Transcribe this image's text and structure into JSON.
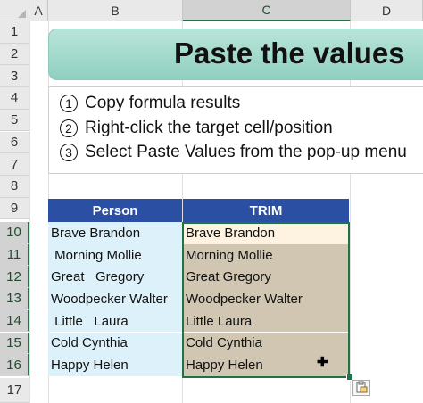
{
  "columns": [
    "A",
    "B",
    "C",
    "D"
  ],
  "rows": [
    "1",
    "2",
    "3",
    "4",
    "5",
    "6",
    "7",
    "8",
    "9",
    "10",
    "11",
    "12",
    "13",
    "14",
    "15",
    "16",
    "17"
  ],
  "banner": {
    "title": "Paste the values"
  },
  "steps": [
    {
      "num": "1",
      "text": "Copy formula results"
    },
    {
      "num": "2",
      "text": "Right-click the target cell/position"
    },
    {
      "num": "3",
      "text": "Select Paste Values from the pop-up menu"
    }
  ],
  "table": {
    "headers": [
      "Person",
      "TRIM"
    ],
    "person": [
      "Brave Brandon",
      " Morning Mollie",
      "Great   Gregory",
      "Woodpecker Walter",
      " Little   Laura",
      "Cold Cynthia",
      "Happy Helen"
    ],
    "trim": [
      "Brave Brandon",
      "Morning Mollie",
      "Great Gregory",
      "Woodpecker Walter",
      "Little Laura",
      "Cold Cynthia",
      "Happy Helen"
    ]
  },
  "icons": {
    "paste_options": "clipboard-icon",
    "cursor": "cross-cursor-icon"
  },
  "colors": {
    "header_blue": "#2b4fa3",
    "banner_teal": "#8fd0c0",
    "selection_green": "#217346",
    "person_fill": "#ddf1fb",
    "trim_fill": "#d1c6b2"
  }
}
